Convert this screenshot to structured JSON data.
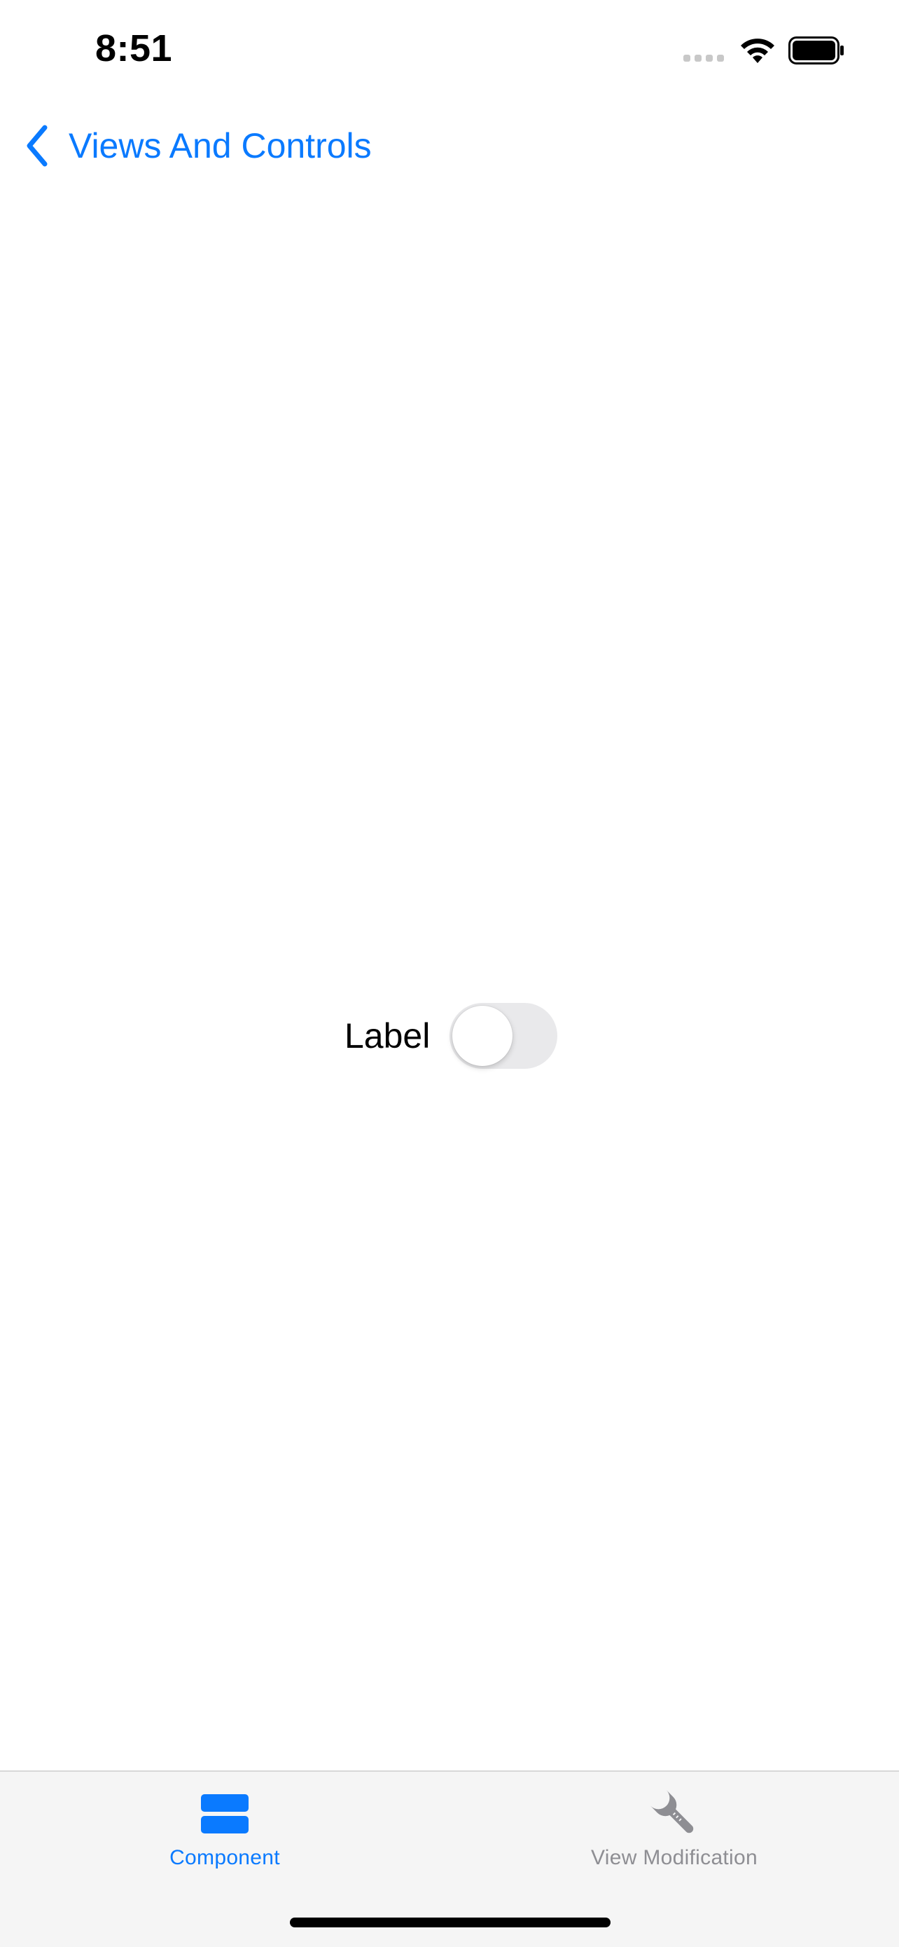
{
  "status_bar": {
    "time": "8:51"
  },
  "nav": {
    "back_label": "Views And Controls",
    "back_icon": "chevron-left-icon"
  },
  "content": {
    "toggle_label": "Label",
    "toggle_on": false
  },
  "tab_bar": {
    "tabs": [
      {
        "label": "Component",
        "icon": "stacked-rectangles-icon",
        "active": true
      },
      {
        "label": "View Modification",
        "icon": "wrench-icon",
        "active": false
      }
    ]
  },
  "colors": {
    "accent": "#0a7aff",
    "inactive": "#8e8e93",
    "switch_off": "#e9e9eb",
    "tab_bar_bg": "#f5f5f5"
  }
}
